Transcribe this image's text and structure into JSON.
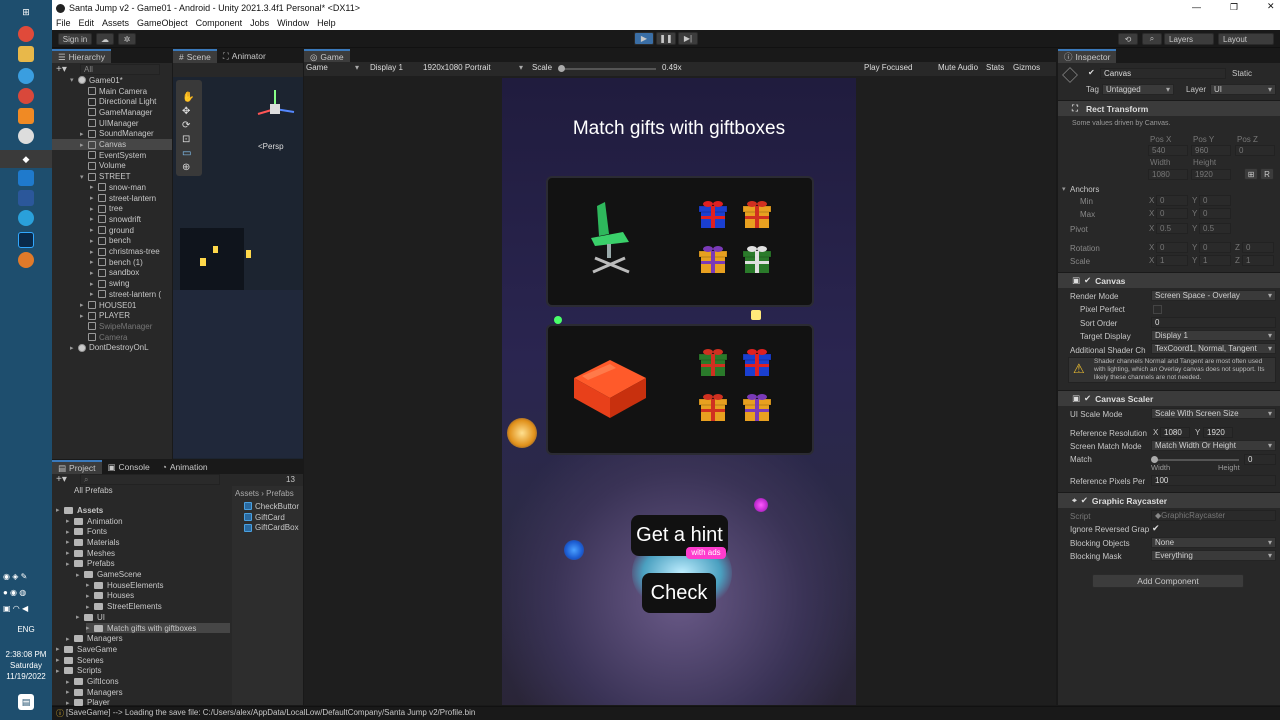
{
  "window": {
    "title": "Santa Jump v2 - Game01 - Android - Unity 2021.3.4f1 Personal* <DX11>"
  },
  "menu": [
    "File",
    "Edit",
    "Assets",
    "GameObject",
    "Component",
    "Jobs",
    "Window",
    "Help"
  ],
  "toolbar": {
    "signin": "Sign in",
    "layers": "Layers",
    "layout": "Layout"
  },
  "hierarchy": {
    "tab": "Hierarchy",
    "search_placeholder": "All",
    "items": [
      {
        "label": "Game01*",
        "indent": 0,
        "arrow": "▾",
        "kind": "scene"
      },
      {
        "label": "Main Camera",
        "indent": 1,
        "arrow": "",
        "kind": "obj"
      },
      {
        "label": "Directional Light",
        "indent": 1,
        "arrow": "",
        "kind": "obj"
      },
      {
        "label": "GameManager",
        "indent": 1,
        "arrow": "",
        "kind": "obj"
      },
      {
        "label": "UIManager",
        "indent": 1,
        "arrow": "",
        "kind": "obj"
      },
      {
        "label": "SoundManager",
        "indent": 1,
        "arrow": "▸",
        "kind": "obj"
      },
      {
        "label": "Canvas",
        "indent": 1,
        "arrow": "▸",
        "kind": "obj",
        "selected": true
      },
      {
        "label": "EventSystem",
        "indent": 1,
        "arrow": "",
        "kind": "obj"
      },
      {
        "label": "Volume",
        "indent": 1,
        "arrow": "",
        "kind": "obj"
      },
      {
        "label": "STREET",
        "indent": 1,
        "arrow": "▾",
        "kind": "obj"
      },
      {
        "label": "snow-man",
        "indent": 2,
        "arrow": "▸",
        "kind": "obj"
      },
      {
        "label": "street-lantern",
        "indent": 2,
        "arrow": "▸",
        "kind": "obj"
      },
      {
        "label": "tree",
        "indent": 2,
        "arrow": "▸",
        "kind": "obj"
      },
      {
        "label": "snowdrift",
        "indent": 2,
        "arrow": "▸",
        "kind": "obj"
      },
      {
        "label": "ground",
        "indent": 2,
        "arrow": "▸",
        "kind": "obj"
      },
      {
        "label": "bench",
        "indent": 2,
        "arrow": "▸",
        "kind": "obj"
      },
      {
        "label": "christmas-tree",
        "indent": 2,
        "arrow": "▸",
        "kind": "obj"
      },
      {
        "label": "bench (1)",
        "indent": 2,
        "arrow": "▸",
        "kind": "obj"
      },
      {
        "label": "sandbox",
        "indent": 2,
        "arrow": "▸",
        "kind": "obj"
      },
      {
        "label": "swing",
        "indent": 2,
        "arrow": "▸",
        "kind": "obj"
      },
      {
        "label": "street-lantern (",
        "indent": 2,
        "arrow": "▸",
        "kind": "obj"
      },
      {
        "label": "HOUSE01",
        "indent": 1,
        "arrow": "▸",
        "kind": "obj"
      },
      {
        "label": "PLAYER",
        "indent": 1,
        "arrow": "▸",
        "kind": "obj"
      },
      {
        "label": "SwipeManager",
        "indent": 1,
        "arrow": "",
        "kind": "obj",
        "dim": true
      },
      {
        "label": "Camera",
        "indent": 1,
        "arrow": "",
        "kind": "obj",
        "dim": true
      },
      {
        "label": "DontDestroyOnL",
        "indent": 0,
        "arrow": "▸",
        "kind": "scene"
      }
    ]
  },
  "scene": {
    "tab": "Scene",
    "tab2": "Animator",
    "persp": "<Persp"
  },
  "game": {
    "tab": "Game",
    "mode": "Game",
    "display": "Display 1",
    "resolution": "1920x1080 Portrait",
    "scale_label": "Scale",
    "scale_value": "0.49x",
    "play_focused": "Play Focused",
    "mute": "Mute Audio",
    "stats": "Stats",
    "gizmos": "Gizmos",
    "heading": "Match gifts with giftboxes",
    "hint_button": "Get a hint",
    "hint_badge": "with ads",
    "check_button": "Check"
  },
  "project": {
    "tabs": [
      "Project",
      "Console",
      "Animation"
    ],
    "favorites": "All Prefabs",
    "count": "13",
    "breadcrumb": [
      "Assets",
      "Prefabs"
    ],
    "tree": [
      {
        "label": "Assets",
        "indent": 0,
        "bold": true
      },
      {
        "label": "Animation",
        "indent": 1
      },
      {
        "label": "Fonts",
        "indent": 1
      },
      {
        "label": "Materials",
        "indent": 1
      },
      {
        "label": "Meshes",
        "indent": 1
      },
      {
        "label": "Prefabs",
        "indent": 1
      },
      {
        "label": "GameScene",
        "indent": 2
      },
      {
        "label": "HouseElements",
        "indent": 3
      },
      {
        "label": "Houses",
        "indent": 3
      },
      {
        "label": "StreetElements",
        "indent": 3
      },
      {
        "label": "UI",
        "indent": 2
      },
      {
        "label": "Match gifts with giftboxes",
        "indent": 3,
        "selected": true
      },
      {
        "label": "Managers",
        "indent": 1
      },
      {
        "label": "SaveGame",
        "indent": 0
      },
      {
        "label": "Scenes",
        "indent": 0
      },
      {
        "label": "Scripts",
        "indent": 0
      },
      {
        "label": "GiftIcons",
        "indent": 1
      },
      {
        "label": "Managers",
        "indent": 1
      },
      {
        "label": "Player",
        "indent": 1
      }
    ],
    "files": [
      "CheckButtor",
      "GiftCard",
      "GiftCardBox"
    ]
  },
  "inspector": {
    "tab": "Inspector",
    "object_name": "Canvas",
    "static": "Static",
    "tag_label": "Tag",
    "tag": "Untagged",
    "layer_label": "Layer",
    "layer": "UI",
    "rect": {
      "title": "Rect Transform",
      "note": "Some values driven by Canvas.",
      "posx": "Pos X",
      "posy": "Pos Y",
      "posz": "Pos Z",
      "vx": "540",
      "vy": "960",
      "vz": "0",
      "w": "Width",
      "h": "Height",
      "vw": "1080",
      "vh": "1920",
      "anchors": "Anchors",
      "min": "Min",
      "max": "Max",
      "pivot": "Pivot",
      "rotation": "Rotation",
      "scale": "Scale",
      "x": "X",
      "y": "Y",
      "z": "Z",
      "min_x": "0",
      "min_y": "0",
      "max_x": "0",
      "max_y": "0",
      "piv_x": "0.5",
      "piv_y": "0.5",
      "rot_x": "0",
      "rot_y": "0",
      "rot_z": "0",
      "sc_x": "1",
      "sc_y": "1",
      "sc_z": "1"
    },
    "canvas": {
      "title": "Canvas",
      "render_mode_label": "Render Mode",
      "render_mode": "Screen Space - Overlay",
      "pixel_perfect": "Pixel Perfect",
      "sort_order_label": "Sort Order",
      "sort_order": "0",
      "target_display_label": "Target Display",
      "target_display": "Display 1",
      "shader_label": "Additional Shader Ch",
      "shader": "TexCoord1, Normal, Tangent",
      "warning": "Shader channels Normal and Tangent are most often used with lighting, which an Overlay canvas does not support. Its likely these channels are not needed."
    },
    "scaler": {
      "title": "Canvas Scaler",
      "ui_scale_label": "UI Scale Mode",
      "ui_scale": "Scale With Screen Size",
      "ref_res_label": "Reference Resolution",
      "x": "X",
      "y": "Y",
      "ref_x": "1080",
      "ref_y": "1920",
      "match_mode_label": "Screen Match Mode",
      "match_mode": "Match Width Or Height",
      "match_label": "Match",
      "match_value": "0",
      "width": "Width",
      "height": "Height",
      "ref_ppu_label": "Reference Pixels Per",
      "ref_ppu": "100"
    },
    "raycaster": {
      "title": "Graphic Raycaster",
      "script_label": "Script",
      "script": "GraphicRaycaster",
      "ignore_label": "Ignore Reversed Grap",
      "blocking_label": "Blocking Objects",
      "blocking": "None",
      "mask_label": "Blocking Mask",
      "mask": "Everything"
    },
    "add_component": "Add Component"
  },
  "status": {
    "message": "[SaveGame] --> Loading the save file: C:/Users/alex/AppData/LocalLow/DefaultCompany/Santa Jump v2/Profile.bin"
  },
  "clock": {
    "time": "2:38:08 PM",
    "day": "Saturday",
    "date": "11/19/2022",
    "lang": "ENG"
  }
}
